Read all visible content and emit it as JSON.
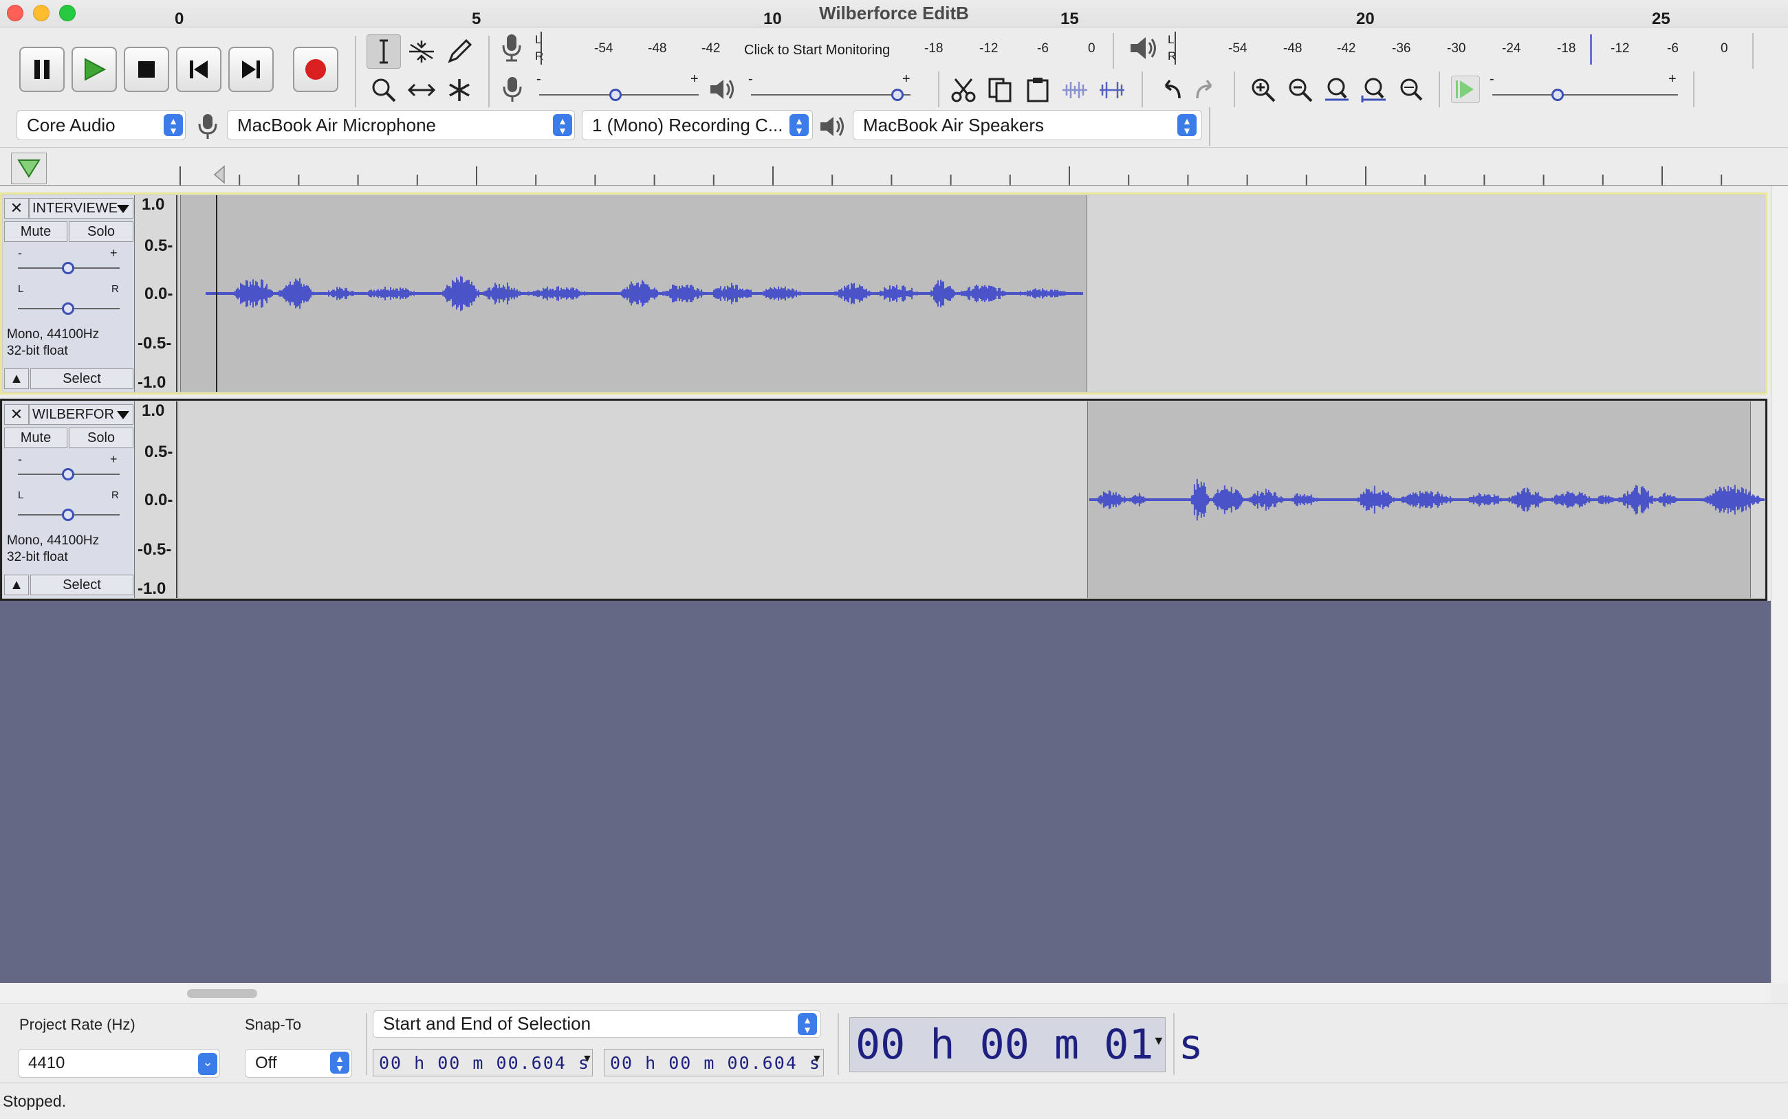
{
  "window": {
    "title": "Wilberforce EditB"
  },
  "transport": {
    "icons": [
      "pause-icon",
      "play-icon",
      "stop-icon",
      "skip-to-start-icon",
      "skip-to-end-icon",
      "record-icon"
    ]
  },
  "tools": {
    "icons": [
      "selection-tool-icon",
      "envelope-tool-icon",
      "draw-tool-icon",
      "zoom-tool-icon",
      "time-shift-tool-icon",
      "multi-tool-icon"
    ]
  },
  "meters": {
    "record": {
      "L": "L",
      "R": "R",
      "ticks": [
        "-54",
        "-48",
        "-42",
        "-18",
        "-12",
        "-6",
        "0"
      ],
      "monitor_label": "Click to Start Monitoring"
    },
    "playback": {
      "L": "L",
      "R": "R",
      "ticks": [
        "-54",
        "-48",
        "-42",
        "-36",
        "-30",
        "-24",
        "-18",
        "-12",
        "-6",
        "0"
      ]
    }
  },
  "mixer": {
    "minus": "-",
    "plus": "+",
    "record_volume": 0.48,
    "playback_volume": 0.92
  },
  "play_at_speed": {
    "minus": "-",
    "plus": "+",
    "speed": 0.35
  },
  "devices": {
    "host": "Core Audio",
    "input": "MacBook Air Microphone",
    "channels": "1 (Mono) Recording C...",
    "output": "MacBook Air Speakers"
  },
  "ruler": {
    "labels": [
      "0",
      "5",
      "10",
      "15",
      "20",
      "25"
    ]
  },
  "tracks": [
    {
      "name": "INTERVIEWE",
      "mute": "Mute",
      "solo": "Solo",
      "gain_minus": "-",
      "gain_plus": "+",
      "pan_left": "L",
      "pan_right": "R",
      "info_line1": "Mono, 44100Hz",
      "info_line2": "32-bit float",
      "select": "Select",
      "scale": [
        "1.0",
        "0.5-",
        "0.0-",
        "-0.5-",
        "-1.0"
      ],
      "clip_start_s": 0.604,
      "clip_end_s": 15.3
    },
    {
      "name": "WILBERFOR",
      "mute": "Mute",
      "solo": "Solo",
      "gain_minus": "-",
      "gain_plus": "+",
      "pan_left": "L",
      "pan_right": "R",
      "info_line1": "Mono, 44100Hz",
      "info_line2": "32-bit float",
      "select": "Select",
      "scale": [
        "1.0",
        "0.5-",
        "0.0-",
        "-0.5-",
        "-1.0"
      ],
      "clip_start_s": 15.3,
      "clip_end_s": 26.5
    }
  ],
  "selection_toolbar": {
    "project_rate_label": "Project Rate (Hz)",
    "project_rate_value": "4410",
    "snap_label": "Snap-To",
    "snap_value": "Off",
    "selection_mode": "Start and End of Selection",
    "start_time": "00 h 00 m 00.604 s",
    "end_time": "00 h 00 m 00.604 s",
    "big_time": "00 h 00 m 01 s"
  },
  "status": {
    "text": "Stopped."
  }
}
